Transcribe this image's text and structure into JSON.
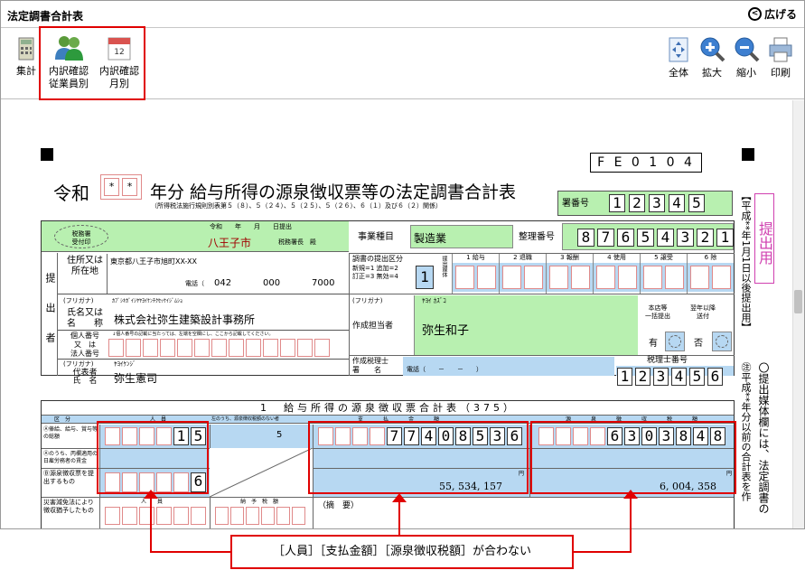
{
  "window": {
    "title": "法定調書合計表",
    "expand_label": "広げる"
  },
  "toolbar": {
    "left_buttons": [
      {
        "label": "集計"
      },
      {
        "label": "内訳確認\n従業員別"
      },
      {
        "label": "内訳確認\n月別"
      }
    ],
    "right_buttons": [
      {
        "label": "全体"
      },
      {
        "label": "拡大"
      },
      {
        "label": "縮小"
      },
      {
        "label": "印刷"
      }
    ],
    "calendar_number": "12"
  },
  "form": {
    "code": "F E 0 1 0 4",
    "era": "令和",
    "year_cells": [
      "*",
      "*"
    ],
    "title": "年分 給与所得の源泉徴収票等の法定調書合計表",
    "subtitle": "（所得税法施行規則別表第５（８）、５（２４）、５（２５）、５（２６）、６（１）及び６（２）関係）",
    "office_no_label": "署番号",
    "office_no": [
      "1",
      "2",
      "3",
      "4",
      "5"
    ],
    "side_red_text": "提出用",
    "date_line": "令和　　年　　月　　日提出",
    "tax_office_stamp": "税務署\n受付印",
    "tax_office_name": "八王子市",
    "tax_office_suffix": "税務署長　殿",
    "business_type_label": "事業種目",
    "business_type": "製造業",
    "ref_no_label": "整理番号",
    "ref_no": [
      "8",
      "7",
      "6",
      "5",
      "4",
      "3",
      "2",
      "1"
    ],
    "submitter_label": "提出者",
    "address_label": "住所又は\n所在地",
    "address": "東京都八王子市旭町XX-XX",
    "phone_label": "電話（",
    "phone": [
      "042",
      "000",
      "7000"
    ],
    "furigana_label": "(フリガナ)",
    "name_kana": "ｶﾌﾞｼｷｶﾞｲｼﾔﾔﾖｲｹﾝﾁｸｾｯｹｲｼﾞﾑｼｮ",
    "name_label": "氏名又は\n名　　称",
    "name": "株式会社弥生建築設計事務所",
    "id_label": "個人番号\n又　は\n法人番号",
    "id_note": "↓個人番号の記載に当たっては、左端を空欄にし、ここから記載してください。",
    "rep_kana": "ﾔﾖｲｹﾝｼﾞ",
    "rep_label": "代表者\n氏　名",
    "rep_name": "弥生憲司",
    "submit_class_label": "調書の提出区分",
    "submit_class_note": "新規=1 追加=2\n訂正=3 無効=4",
    "submit_class": "1",
    "media_label": "提出媒体",
    "media_cols": [
      "1 給与",
      "2 退職",
      "3 報酬",
      "4 使用",
      "5 譲受",
      "6 除",
      ""
    ],
    "contact_kana": "ﾔﾖｲ ｶｽﾞｺ",
    "contact_label": "作成担当者",
    "contact_name": "弥生和子",
    "branch_label": "本店等\n一括提出",
    "next_year_label": "翌年以降\n送付",
    "has_label": "有",
    "none_label": "否",
    "tax_accountant_label": "作成税理士\n署　　名",
    "tax_accountant_phone": "電話（　　－　　－　　）",
    "tax_accountant_no_label": "税理士番号",
    "tax_accountant_no": [
      "1",
      "2",
      "3",
      "4",
      "5",
      "6"
    ],
    "note_vertical": "〇提出媒体欄には、法定調書の",
    "heisei_note": "【平成**年1月1日以後提出用】",
    "heisei_note2": "㊟平成**年分以前の合計表を作",
    "section_title": "1　給与所得の源泉徴収票合計表（375）",
    "col_heads": [
      "区　分",
      "人　員",
      "左のうち、源泉徴収税額のない者",
      "支　払　金　額",
      "源　泉　徴　収　税　額"
    ],
    "row_labels": [
      "Ⓐ俸給、給与、賞与等の総額",
      "Ⓐのうち、丙欄適用の日雇労務者の賃金",
      "Ⓑ源泉徴収票を提出するもの",
      "災害減免法により徴収猶予したもの"
    ],
    "row_a_persons": [
      "1",
      "5"
    ],
    "row_a_none": "5",
    "row_a_payment": [
      "7",
      "7",
      "4",
      "0",
      "8",
      "5",
      "3",
      "6"
    ],
    "row_a_tax": [
      "6",
      "3",
      "0",
      "3",
      "8",
      "4",
      "8"
    ],
    "row_b_persons": [
      "6"
    ],
    "row_b_payment": "55, 534, 157",
    "row_b_tax": "6, 004, 358",
    "yen": "円",
    "remarks_label": "（摘　要）",
    "person_head": "人　　員",
    "deferred_head": "納　予　税　額"
  },
  "annotation": "［人員］［支払金額］［源泉徴収税額］が合わない"
}
